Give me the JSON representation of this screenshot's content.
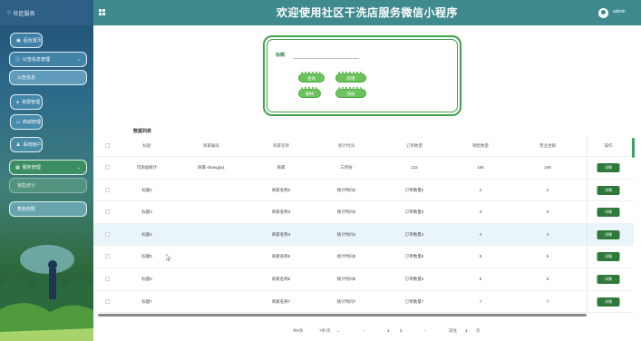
{
  "sidebar": {
    "top_label": "社区服务",
    "items": [
      {
        "label": "后台首页"
      },
      {
        "label": "公告信息管理"
      },
      {
        "label": "公告信息"
      },
      {
        "label": "资源管理"
      },
      {
        "label": "商城管理"
      },
      {
        "label": "系统用户"
      },
      {
        "label": "服务管理"
      },
      {
        "label": "销售统计"
      },
      {
        "label": "角色权限"
      }
    ]
  },
  "header": {
    "title": "欢迎使用社区干洗店服务微信小程序",
    "user": "admin"
  },
  "search": {
    "label": "标题",
    "buttons": {
      "query": "查询",
      "add": "新增",
      "delete": "删除",
      "add2": "添加"
    }
  },
  "list": {
    "title": "数据列表",
    "columns": [
      "标题",
      "商家编号",
      "商家名称",
      "统计时间",
      "订单数量",
      "销售数量",
      "营业金额",
      "操作"
    ],
    "rows": [
      [
        "可添加统计",
        "商家-shangjia1",
        "商家",
        "三月份",
        "122",
        "165",
        "246"
      ],
      [
        "标题2",
        "",
        "商家名称2",
        "统计时间2",
        "订单数量2",
        "2",
        "2"
      ],
      [
        "标题3",
        "",
        "商家名称3",
        "统计时间3",
        "订单数量3",
        "3",
        "3"
      ],
      [
        "标题4",
        "",
        "商家名称4",
        "统计时间4",
        "订单数量4",
        "4",
        "4"
      ],
      [
        "标题5",
        "",
        "商家名称5",
        "统计时间5",
        "订单数量5",
        "5",
        "5"
      ],
      [
        "标题6",
        "",
        "商家名称6",
        "统计时间6",
        "订单数量6",
        "6",
        "6"
      ],
      [
        "标题7",
        "",
        "商家名称7",
        "统计时间7",
        "订单数量7",
        "7",
        "7"
      ]
    ],
    "action_label": "详情"
  },
  "pagination": {
    "total": "共8条",
    "page_size": "7条/页",
    "prev": "‹",
    "pages": [
      "1",
      "2"
    ],
    "next": "›",
    "goto_label": "前往",
    "goto_value": "1",
    "page_suffix": "页"
  },
  "colors": {
    "header": "#3f8a8d",
    "accent": "#3ea04a",
    "detail": "#2f7a3a"
  }
}
